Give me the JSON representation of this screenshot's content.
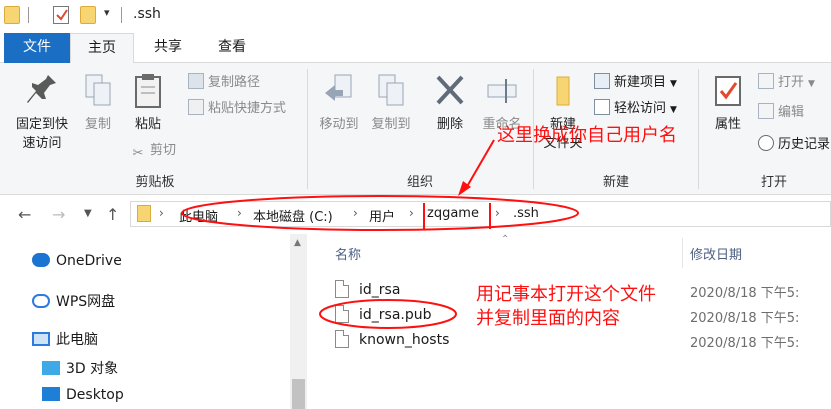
{
  "window": {
    "title": ".ssh",
    "quick_access_dropdown": "▾"
  },
  "tabs": [
    {
      "label": "文件"
    },
    {
      "label": "主页"
    },
    {
      "label": "共享"
    },
    {
      "label": "查看"
    }
  ],
  "ribbon": {
    "clipboard": {
      "pin_label_1": "固定到快",
      "pin_label_2": "速访问",
      "copy_label": "复制",
      "paste_label": "粘贴",
      "copy_path_label": "复制路径",
      "paste_shortcut_label": "粘贴快捷方式",
      "cut_label": "剪切",
      "group_label": "剪贴板"
    },
    "organize": {
      "move_to_label": "移动到",
      "copy_to_label": "复制到",
      "delete_label": "删除",
      "rename_label": "重命名",
      "group_label": "组织"
    },
    "new": {
      "new_folder_label_1": "新建",
      "new_folder_label_2": "文件夹",
      "new_item_label": "新建项目",
      "easy_access_label": "轻松访问",
      "group_label": "新建"
    },
    "open": {
      "properties_label": "属性",
      "open_label": "打开",
      "edit_label": "编辑",
      "history_label": "历史记录",
      "group_label": "打开"
    }
  },
  "address_bar": {
    "breadcrumbs": [
      "此电脑",
      "本地磁盘 (C:)",
      "用户",
      "zqgame",
      ".ssh"
    ],
    "separator": "›"
  },
  "navigation_pane": {
    "items": [
      {
        "label": "OneDrive",
        "icon": "cloud-icon"
      },
      {
        "label": "WPS网盘",
        "icon": "cloud-outline-icon"
      },
      {
        "label": "此电脑",
        "icon": "computer-icon"
      },
      {
        "label": "3D 对象",
        "icon": "cube-icon"
      },
      {
        "label": "Desktop",
        "icon": "desktop-icon"
      }
    ]
  },
  "file_list": {
    "columns": {
      "name": "名称",
      "date_modified": "修改日期"
    },
    "files": [
      {
        "name": "id_rsa",
        "date": "2020/8/18 下午5:"
      },
      {
        "name": "id_rsa.pub",
        "date": "2020/8/18 下午5:"
      },
      {
        "name": "known_hosts",
        "date": "2020/8/18 下午5:"
      }
    ]
  },
  "annotations": {
    "username_note": "这里换成你自己用户名",
    "open_note_line1": "用记事本打开这个文件",
    "open_note_line2": "并复制里面的内容"
  },
  "colors": {
    "accent": "#1a6ec3",
    "annotation_red": "#ff1010",
    "folder_yellow": "#f8d573"
  }
}
